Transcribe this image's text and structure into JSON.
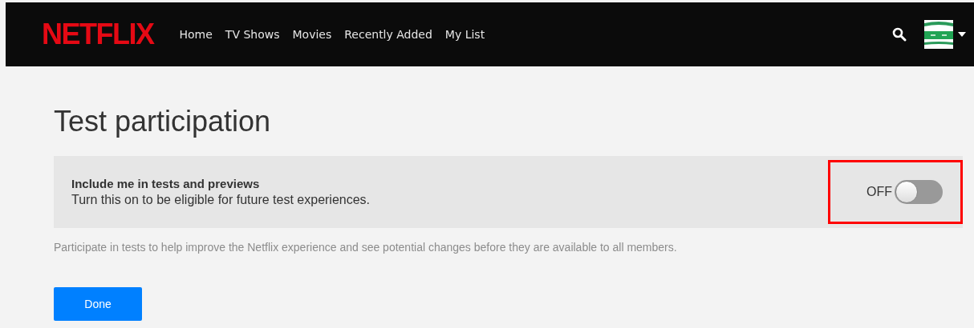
{
  "header": {
    "logo": "NETFLIX",
    "nav": [
      {
        "label": "Home"
      },
      {
        "label": "TV Shows"
      },
      {
        "label": "Movies"
      },
      {
        "label": "Recently Added"
      },
      {
        "label": "My List"
      }
    ]
  },
  "title": "Test participation",
  "setting": {
    "heading": "Include me in tests and previews",
    "description": "Turn this on to be eligible for future test experiences.",
    "state_label": "OFF",
    "on": false,
    "highlighted": true
  },
  "note": "Participate in tests to help improve the Netflix experience and see potential changes before they are available to all members.",
  "buttons": [
    "Done"
  ]
}
